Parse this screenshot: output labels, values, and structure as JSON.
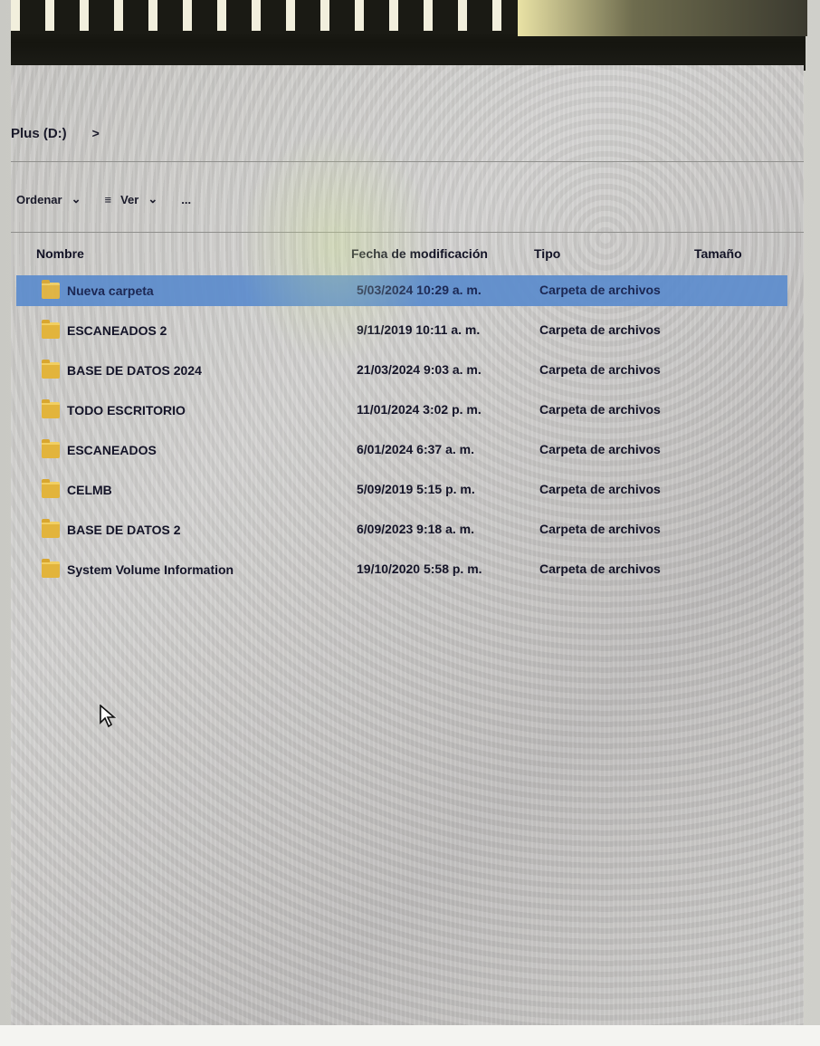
{
  "explorer": {
    "address": {
      "location": "Plus (D:)",
      "chevron": ">"
    },
    "toolbar": {
      "organize": "Ordenar",
      "organize_arrow": "⌄",
      "view_icon": "≡",
      "view": "Ver",
      "view_arrow": "⌄",
      "more": "..."
    },
    "columns": {
      "name": "Nombre",
      "date": "Fecha de modificación",
      "type": "Tipo",
      "size": "Tamaño"
    },
    "files": [
      {
        "name": "Nueva carpeta",
        "date": "5/03/2024 10:29 a. m.",
        "type": "Carpeta de archivos",
        "selected": true
      },
      {
        "name": "ESCANEADOS 2",
        "date": "9/11/2019 10:11 a. m.",
        "type": "Carpeta de archivos",
        "selected": false
      },
      {
        "name": "BASE DE DATOS 2024",
        "date": "21/03/2024 9:03 a. m.",
        "type": "Carpeta de archivos",
        "selected": false
      },
      {
        "name": "TODO ESCRITORIO",
        "date": "11/01/2024 3:02 p. m.",
        "type": "Carpeta de archivos",
        "selected": false
      },
      {
        "name": "ESCANEADOS",
        "date": "6/01/2024 6:37 a. m.",
        "type": "Carpeta de archivos",
        "selected": false
      },
      {
        "name": "CELMB",
        "date": "5/09/2019 5:15 p. m.",
        "type": "Carpeta de archivos",
        "selected": false
      },
      {
        "name": "BASE DE DATOS 2",
        "date": "6/09/2023 9:18 a. m.",
        "type": "Carpeta de archivos",
        "selected": false
      },
      {
        "name": "System Volume Information",
        "date": "19/10/2020 5:58 p. m.",
        "type": "Carpeta de archivos",
        "selected": false
      }
    ]
  },
  "colors": {
    "selection": "#5c8ccd",
    "folder": "#e2b43c",
    "text": "#141428"
  },
  "icons": [
    "folder-icon",
    "cursor-icon",
    "view-icon"
  ]
}
